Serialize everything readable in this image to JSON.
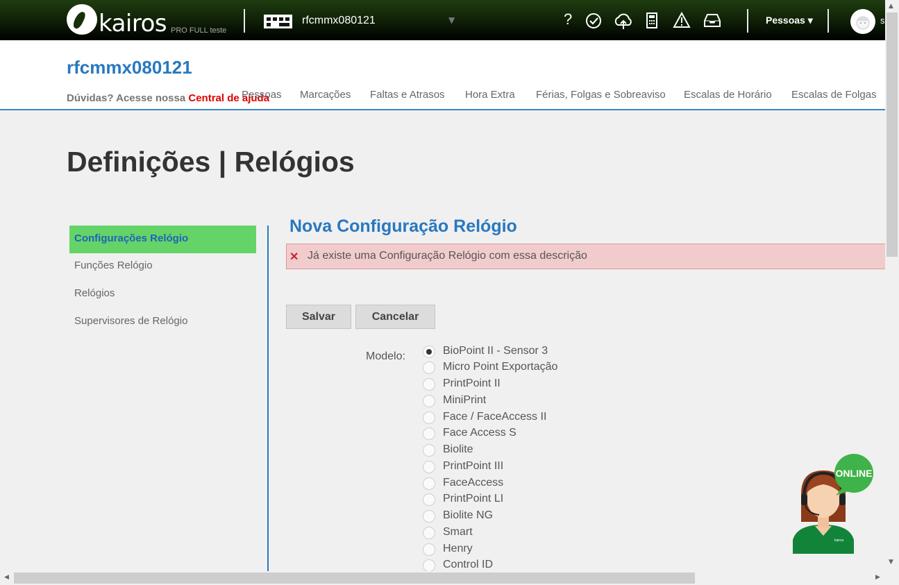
{
  "header": {
    "logo_text": "kairos",
    "logo_sub": "PRO FULL teste",
    "company_name": "rfcmmx080121",
    "company_caret": "▼",
    "icons": [
      "help-icon",
      "clock-check-icon",
      "cloud-upload-icon",
      "calculator-icon",
      "warning-icon",
      "inbox-icon"
    ],
    "help_glyph": "?",
    "people_menu": "Pessoas ▾",
    "avatar_extra": "s"
  },
  "subheader": {
    "title": "rfcmmx080121",
    "help_prefix": "Dúvidas? Acesse nossa ",
    "help_link": "Central de ajuda",
    "nav": [
      "Pessoas",
      "Marcações",
      "Faltas e Atrasos",
      "Hora Extra",
      "Férias, Folgas e Sobreaviso",
      "Escalas de Horário",
      "Escalas de Folgas"
    ]
  },
  "page_title": "Definições | Relógios",
  "left_menu": [
    "Configurações Relógio",
    "Funções Relógio",
    "Relógios",
    "Supervisores de Relógio"
  ],
  "form": {
    "title": "Nova Configuração Relógio",
    "error_icon": "✕",
    "error_message": "Já existe uma Configuração Relógio com essa descrição",
    "save_label": "Salvar",
    "cancel_label": "Cancelar",
    "model_label": "Modelo:",
    "models": [
      "BioPoint II - Sensor 3",
      "Micro Point Exportação",
      "PrintPoint II",
      "MiniPrint",
      "Face / FaceAccess II",
      "Face Access S",
      "Biolite",
      "PrintPoint III",
      "FaceAccess",
      "PrintPoint LI",
      "Biolite NG",
      "Smart",
      "Henry",
      "Control ID"
    ],
    "selected_model": "BioPoint II - Sensor 3"
  },
  "chat_widget": {
    "badge": "ONLINE",
    "shirt_text": "kairos"
  },
  "colors": {
    "accent_blue": "#2878c0",
    "active_green": "#64d468",
    "error_bg": "#f2cccc",
    "help_link_red": "#e00000",
    "header_dark": "#0e1e06"
  }
}
